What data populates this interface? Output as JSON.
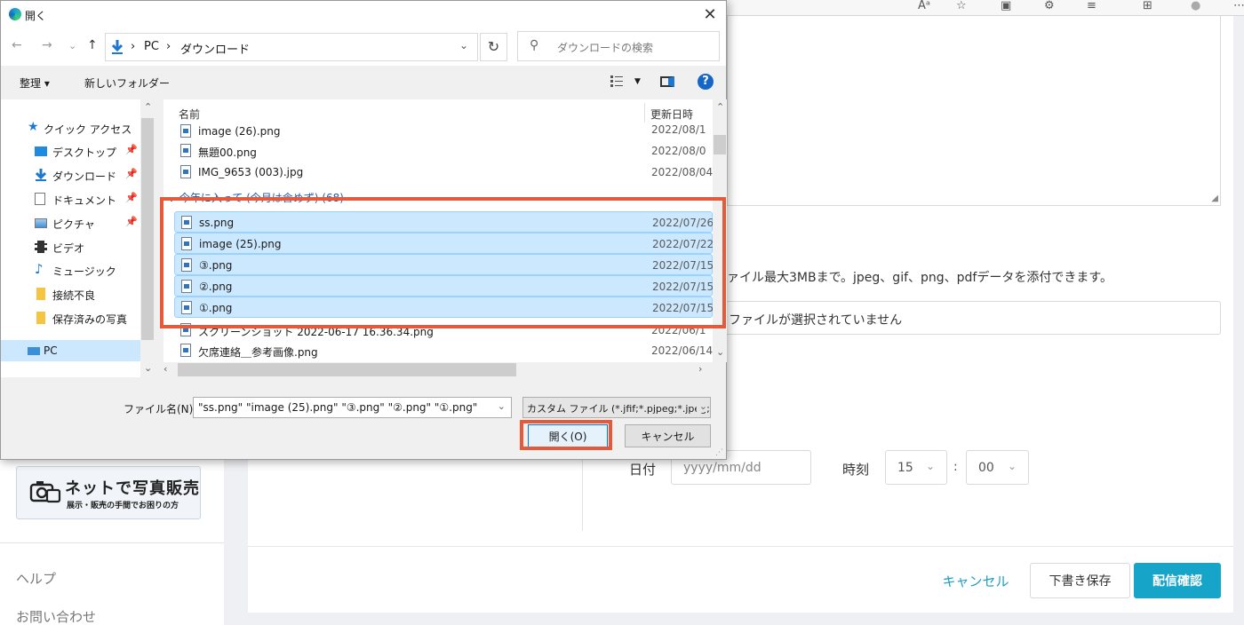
{
  "browser": {
    "toolbar_items": [
      "Aᵃ",
      "☆",
      "▣",
      "⚙",
      "≡",
      "⊞",
      "●",
      "⋯"
    ]
  },
  "web": {
    "banner": {
      "title": "ネットで写真販売",
      "subtitle": "展示・販売の手間でお困りの方"
    },
    "nav_links": [
      "ヘルプ",
      "お問い合わせ"
    ],
    "attach_note": "ァイル最大3MBまで。jpeg、gif、png、pdfデータを添付できます。",
    "file_status": "ファイルが選択されていません",
    "date_label": "日付",
    "date_placeholder": "yyyy/mm/dd",
    "time_label": "時刻",
    "hour": "15",
    "minute": "00",
    "colon": ":",
    "buttons": {
      "cancel": "キャンセル",
      "draft": "下書き保存",
      "confirm": "配信確認"
    }
  },
  "dialog": {
    "title": "開く",
    "close": "✕",
    "nav": {
      "back": "←",
      "forward": "→",
      "recent": "⌄",
      "up": "↑"
    },
    "address": {
      "segments": [
        "PC",
        "ダウンロード"
      ],
      "separator": "›"
    },
    "search_placeholder": "ダウンロードの検索",
    "commands": {
      "organize": "整理 ▾",
      "new_folder": "新しいフォルダー",
      "help": "?"
    },
    "nav_items": [
      {
        "label": "クイック アクセス",
        "icon": "star-icon",
        "pinned": false
      },
      {
        "label": "デスクトップ",
        "icon": "desktop-icon",
        "pinned": true
      },
      {
        "label": "ダウンロード",
        "icon": "download-icon",
        "pinned": true
      },
      {
        "label": "ドキュメント",
        "icon": "document-icon",
        "pinned": true
      },
      {
        "label": "ピクチャ",
        "icon": "pictures-icon",
        "pinned": true
      },
      {
        "label": "ビデオ",
        "icon": "video-icon",
        "pinned": false
      },
      {
        "label": "ミュージック",
        "icon": "music-icon",
        "pinned": false
      },
      {
        "label": "接続不良",
        "icon": "folder-icon",
        "pinned": false
      },
      {
        "label": "保存済みの写真",
        "icon": "folder-icon",
        "pinned": false
      },
      {
        "label": "PC",
        "icon": "pc-icon",
        "pinned": false
      }
    ],
    "columns": {
      "name": "名前",
      "modified": "更新日時"
    },
    "clipped_top_date": "2022/08/1",
    "files": [
      {
        "name": "image (26).png",
        "date": "2022/08/1",
        "selected": false
      },
      {
        "name": "無題00.png",
        "date": "2022/08/0",
        "selected": false
      },
      {
        "name": "IMG_9653 (003).jpg",
        "date": "2022/08/04",
        "selected": false
      },
      {
        "name": "ss.png",
        "date": "2022/07/26",
        "selected": true
      },
      {
        "name": "image (25).png",
        "date": "2022/07/22",
        "selected": true
      },
      {
        "name": "③.png",
        "date": "2022/07/15",
        "selected": true
      },
      {
        "name": "②.png",
        "date": "2022/07/15",
        "selected": true
      },
      {
        "name": "①.png",
        "date": "2022/07/15",
        "selected": true
      },
      {
        "name": "スクリーンショット 2022-06-17 16.36.34.png",
        "date": "2022/06/1",
        "selected": false
      },
      {
        "name": "欠席連絡＿参考画像.png",
        "date": "2022/06/14",
        "selected": false
      }
    ],
    "group_header": "⌄ 今年に入って (今月は含めず) (68)",
    "filename_label": "ファイル名(N):",
    "filename_value": "\"ss.png\" \"image (25).png\" \"③.png\" \"②.png\" \"①.png\"",
    "filetype": "カスタム ファイル (*.jfif;*.pjpeg;*.jpeg;*.pjp;*.jpg)",
    "open_button": "開く(O)",
    "cancel_button": "キャンセル"
  },
  "colors": {
    "highlight": "#e55a3a",
    "selection": "#cce8ff",
    "accent": "#16a4c8"
  }
}
